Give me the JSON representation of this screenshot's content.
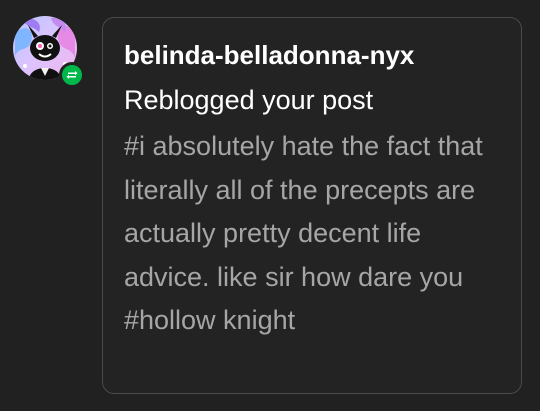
{
  "activity": {
    "username": "belinda-belladonna-nyx",
    "action": "Reblogged your post",
    "tags": [
      "#i absolutely hate the fact that literally all of the precepts are actually pretty decent life advice. like sir how dare you",
      "#hollow knight"
    ]
  },
  "colors": {
    "background": "#212121",
    "card_border": "#4a4a4a",
    "username": "#ffffff",
    "tags": "#a6a6a6",
    "reblog_badge": "#00b84a"
  },
  "icons": {
    "avatar": "avatar-image",
    "badge": "reblog-icon"
  }
}
